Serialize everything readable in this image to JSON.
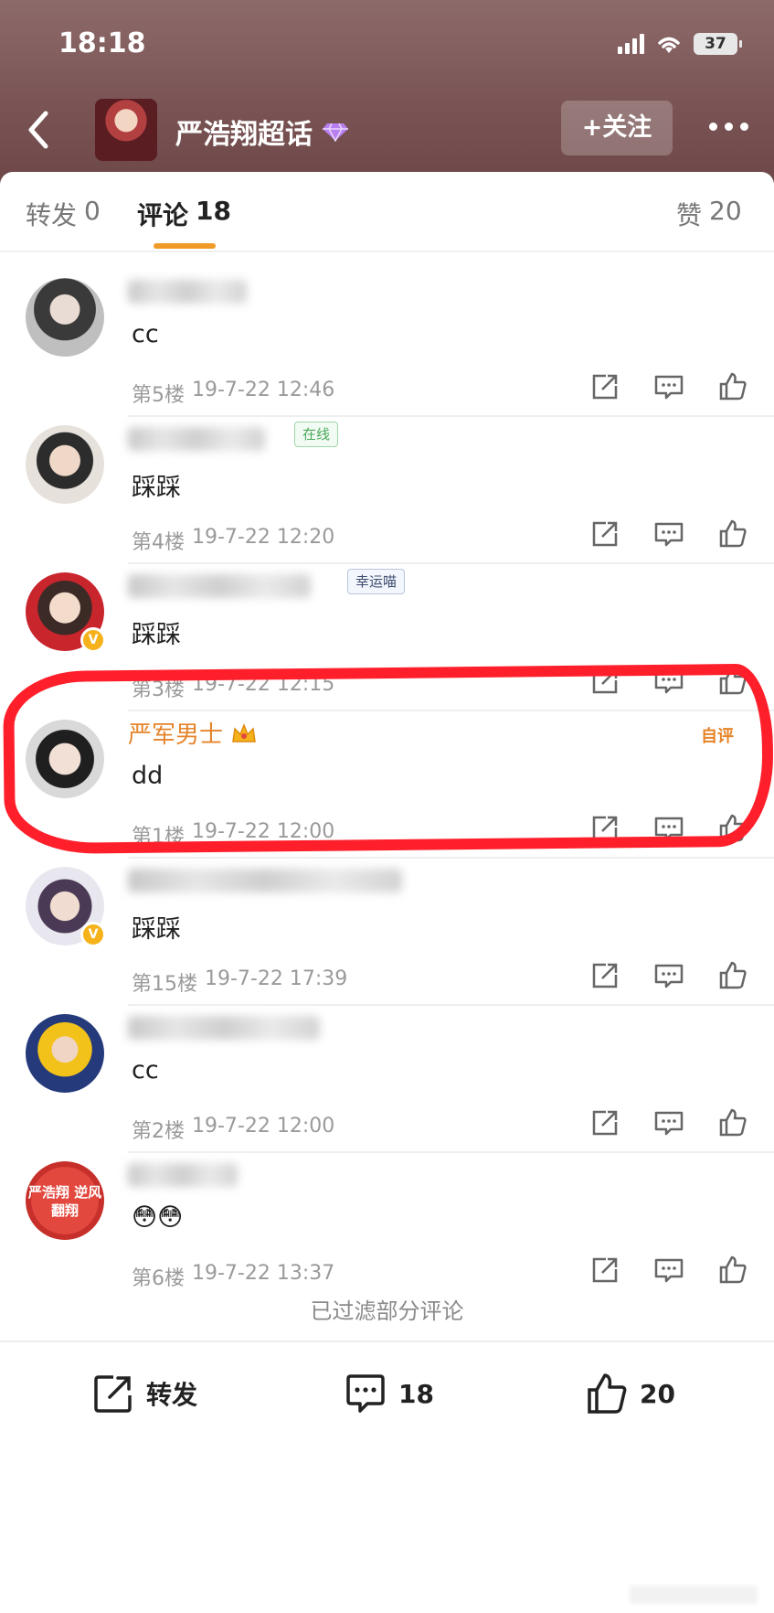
{
  "status_bar": {
    "time": "18:18",
    "battery": "37"
  },
  "header": {
    "title": "严浩翔超话",
    "follow_label": "+关注"
  },
  "tabs": [
    {
      "label": "转发",
      "count": "0"
    },
    {
      "label": "评论",
      "count": "18"
    },
    {
      "label": "赞",
      "count": "20"
    }
  ],
  "comments": [
    {
      "text": "cc",
      "floor": "第5楼",
      "time": "19-7-22 12:46"
    },
    {
      "tag": "在线",
      "text": "踩踩",
      "floor": "第4楼",
      "time": "19-7-22 12:20"
    },
    {
      "tag": "幸运喵",
      "text": "踩踩",
      "floor": "第3楼",
      "time": "19-7-22 12:15"
    },
    {
      "name": "严军男士",
      "author_tag": "自评",
      "text": "dd",
      "floor": "第1楼",
      "time": "19-7-22 12:00"
    },
    {
      "text": "踩踩",
      "floor": "第15楼",
      "time": "19-7-22 17:39"
    },
    {
      "text": "cc",
      "floor": "第2楼",
      "time": "19-7-22 12:00"
    },
    {
      "avatar_text": "严浩翔 逆风翻翔",
      "text": "😳😳",
      "floor": "第6楼",
      "time": "19-7-22 13:37"
    }
  ],
  "filtered_note": "已过滤部分评论",
  "bottom_bar": {
    "repost_label": "转发",
    "comment_count": "18",
    "like_count": "20"
  },
  "colors": {
    "accent": "#f09a2a",
    "name_highlight": "#e5842a",
    "annotation_red": "#ff1f2b"
  },
  "icons": [
    "back-icon",
    "diamond-icon",
    "more-icon",
    "share-icon",
    "comment-icon",
    "like-icon",
    "crown-icon",
    "verified-icon"
  ]
}
